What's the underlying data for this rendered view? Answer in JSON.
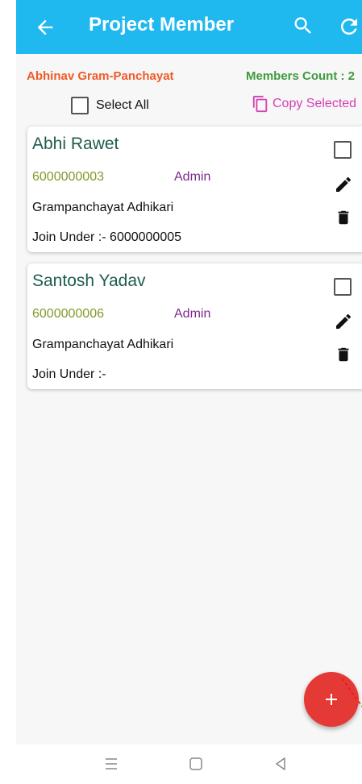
{
  "appbar": {
    "title": "Project Member",
    "icons": [
      "back-arrow-icon",
      "search-icon",
      "refresh-icon"
    ],
    "color": "#1fb8ef"
  },
  "info": {
    "panchayat": "Abhinav Gram-Panchayat",
    "members_count": "Members Count : 2",
    "select_all": "Select All",
    "copy_selected": "Copy Selected"
  },
  "members": [
    {
      "name": "Abhi Rawet",
      "phone": "6000000003",
      "role": "Admin",
      "designation": "Grampanchayat Adhikari",
      "join_under": "Join Under :- 6000000005"
    },
    {
      "name": "Santosh Yadav",
      "phone": "6000000006",
      "role": "Admin",
      "designation": "Grampanchayat Adhikari",
      "join_under": "Join Under :-"
    }
  ],
  "fab": {
    "icon": "plus-icon",
    "color": "#e53935"
  },
  "system_nav": {
    "icons": [
      "menu-icon",
      "home-icon",
      "back-icon"
    ]
  }
}
